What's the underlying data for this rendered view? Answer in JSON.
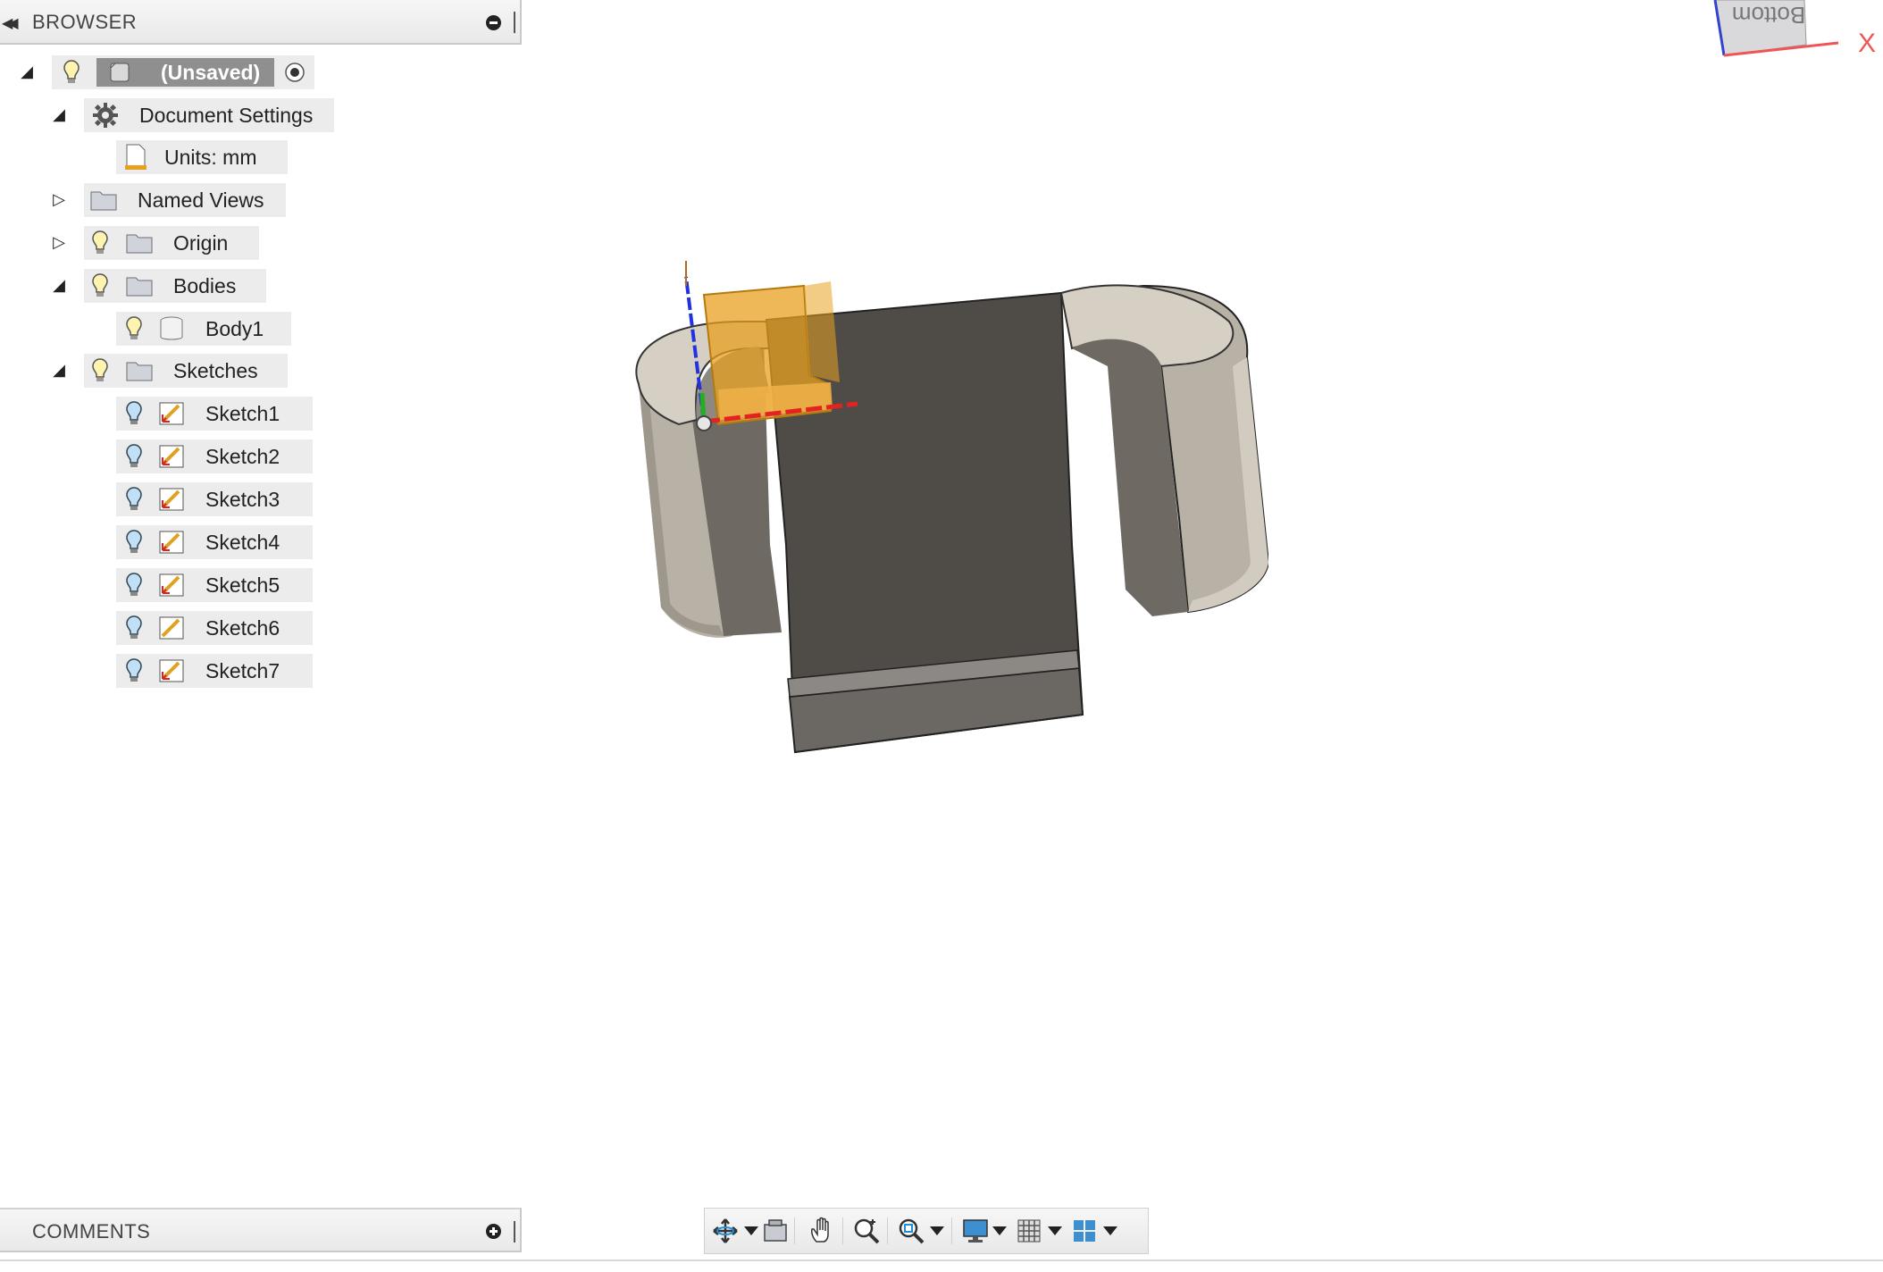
{
  "browser": {
    "title": "BROWSER",
    "root": {
      "label": "(Unsaved)"
    },
    "items": [
      {
        "label": "Document Settings"
      },
      {
        "label": "Units: mm"
      },
      {
        "label": "Named Views"
      },
      {
        "label": "Origin"
      },
      {
        "label": "Bodies"
      },
      {
        "label": "Body1"
      },
      {
        "label": "Sketches"
      }
    ],
    "sketches": [
      {
        "label": "Sketch1"
      },
      {
        "label": "Sketch2"
      },
      {
        "label": "Sketch3"
      },
      {
        "label": "Sketch4"
      },
      {
        "label": "Sketch5"
      },
      {
        "label": "Sketch6"
      },
      {
        "label": "Sketch7"
      }
    ]
  },
  "comments": {
    "title": "COMMENTS"
  },
  "viewcube": {
    "face_label": "Bottom",
    "axis_label": "X"
  },
  "colors": {
    "model_dark": "#4f4c48",
    "model_light": "#d6d0c4",
    "sketch_orange": "#e8a020",
    "axis_x": "#e52222",
    "axis_y": "#22b022",
    "axis_z": "#2233dd"
  },
  "navbar": {
    "icons": [
      "orbit-icon",
      "look-at-icon",
      "pan-icon",
      "zoom-icon",
      "fit-icon",
      "display-settings-icon",
      "grid-icon",
      "viewports-icon"
    ]
  }
}
